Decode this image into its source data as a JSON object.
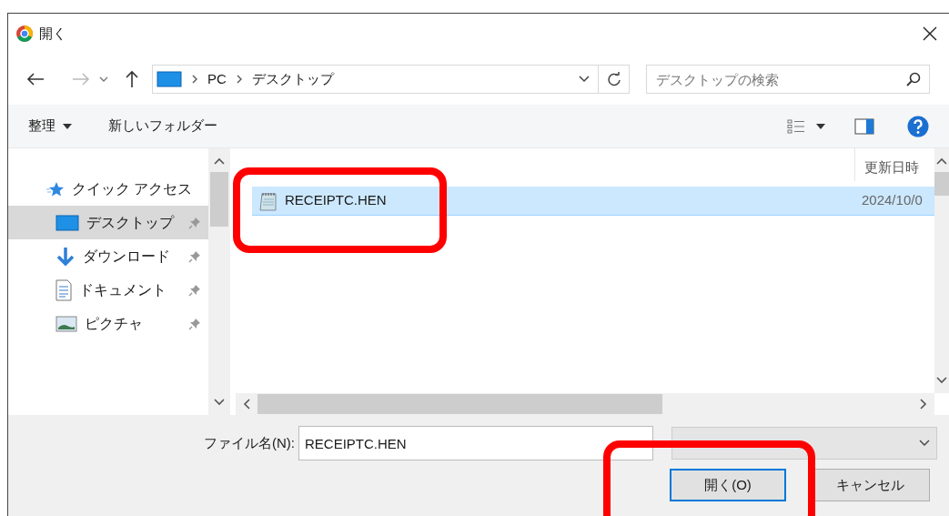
{
  "window": {
    "title": "開く"
  },
  "address": {
    "path": [
      "PC",
      "デスクトップ"
    ]
  },
  "search": {
    "placeholder": "デスクトップの検索"
  },
  "toolbar": {
    "items": [
      {
        "label": "整理",
        "kind": "menu"
      },
      {
        "label": "新しいフォルダー",
        "kind": "command"
      }
    ]
  },
  "nav": {
    "items": [
      {
        "label": "クイック アクセス",
        "kind": "quick-access",
        "selected": false,
        "pinned": false
      },
      {
        "label": "デスクトップ",
        "kind": "desktop",
        "selected": true,
        "pinned": true
      },
      {
        "label": "ダウンロード",
        "kind": "downloads",
        "selected": false,
        "pinned": true
      },
      {
        "label": "ドキュメント",
        "kind": "documents",
        "selected": false,
        "pinned": true
      },
      {
        "label": "ピクチャ",
        "kind": "pictures",
        "selected": false,
        "pinned": true
      }
    ]
  },
  "file_list": {
    "date_column": "更新日時",
    "rows": [
      {
        "name": "RECEIPTC.HEN",
        "modified": "2024/10/0",
        "selected": true
      }
    ]
  },
  "file_name": {
    "label": "ファイル名(N):",
    "value": "RECEIPTC.HEN"
  },
  "buttons": [
    {
      "label": "開く(O)",
      "kind": "default"
    },
    {
      "label": "キャンセル",
      "kind": "normal"
    }
  ]
}
